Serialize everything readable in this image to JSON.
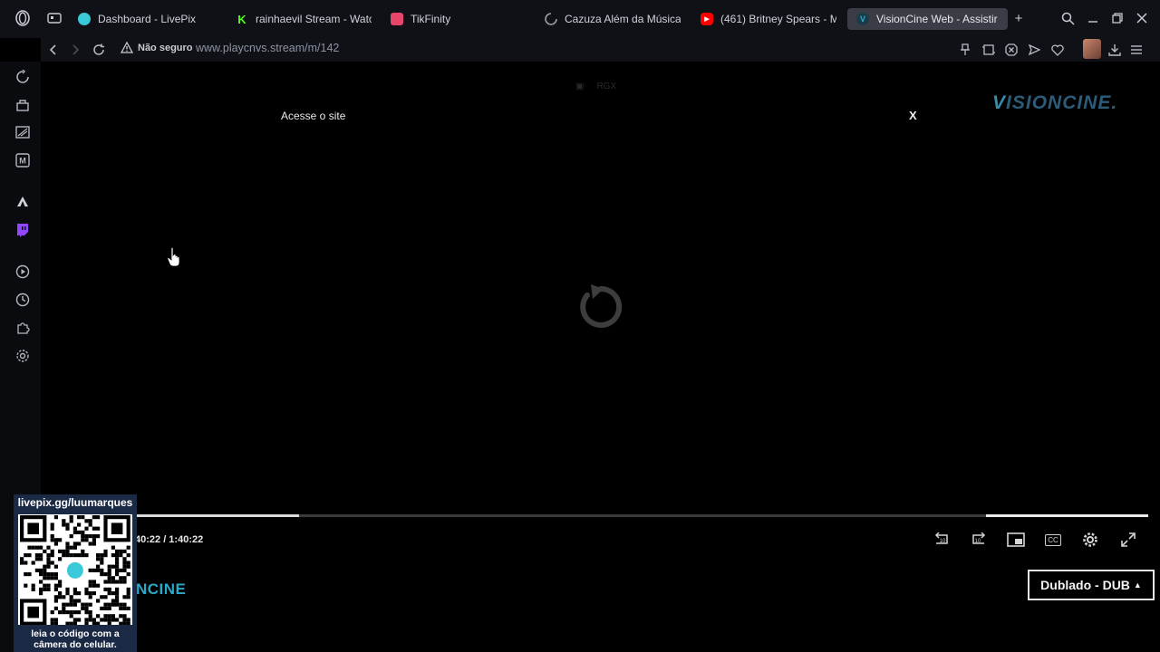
{
  "browser": {
    "tabs": [
      {
        "label": "Dashboard - LivePix",
        "favicon": "livepix-icon",
        "color": "#3ac9d9"
      },
      {
        "label": "rainhaevil Stream - Watc",
        "favicon": "kick-icon",
        "color": "#53fc18"
      },
      {
        "label": "TikFinity",
        "favicon": "tikfinity-icon",
        "color": "#e8456b"
      },
      {
        "label": "Cazuza Além da Música",
        "favicon": "loading-spinner-icon",
        "color": "#888888"
      },
      {
        "label": "(461) Britney Spears - M",
        "favicon": "youtube-icon",
        "color": "#ff0000"
      },
      {
        "label": "VisionCine Web - Assistir",
        "favicon": "visioncine-icon",
        "color": "#2aa8c7",
        "active": true
      }
    ],
    "security_label": "Não seguro",
    "url": "www.playcnvs.stream/m/142"
  },
  "player": {
    "promo_label": "Acesse o site",
    "close_label": "X",
    "overlay_small_text": "RGX",
    "logo_text": "ISIONCINE.",
    "logo_first_letter": "V",
    "time_display": "40:22 / 1:40:22",
    "progress_fraction": 0.16,
    "buffered_fraction": 0.84,
    "brand_fragment": "NCINE",
    "audio_option": "Dublado - DUB"
  },
  "overlay": {
    "qr_header": "livepix.gg/luumarques",
    "qr_caption_line1": "leia o código com a",
    "qr_caption_line2": "câmera do celular."
  },
  "colors": {
    "accent": "#2aa8c7",
    "tab_active_bg": "#3a3d45"
  }
}
